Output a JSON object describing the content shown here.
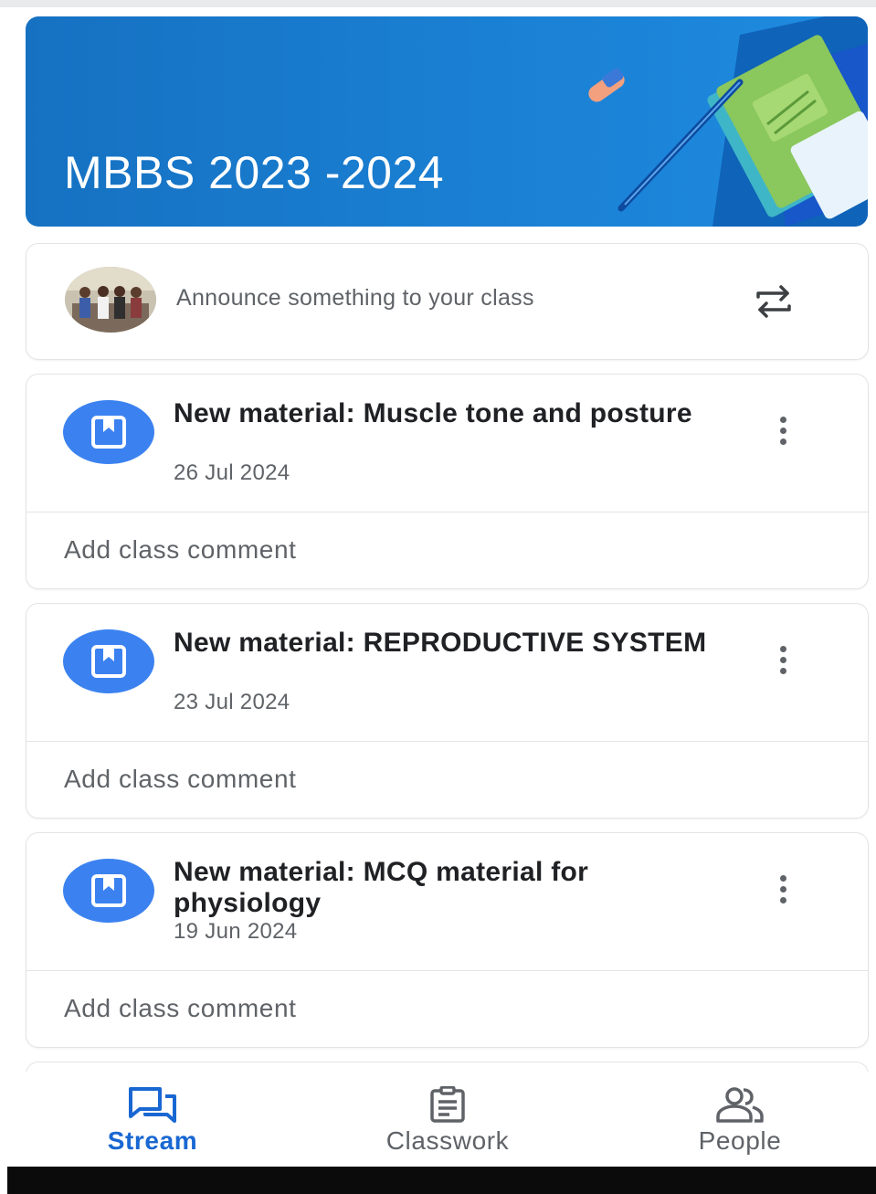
{
  "banner": {
    "title": "MBBS 2023 -2024",
    "colors": {
      "background": "#1a80d3"
    }
  },
  "announce": {
    "placeholder": "Announce something to your class",
    "avatar_icon": "class-photo-avatar",
    "repost_icon": "repost-icon"
  },
  "posts": [
    {
      "title": "New material: Muscle tone and posture",
      "date": "26 Jul 2024",
      "comment_label": "Add class comment",
      "icon": "material-bookmark-icon"
    },
    {
      "title": "New material: REPRODUCTIVE SYSTEM",
      "date": "23 Jul 2024",
      "comment_label": "Add class comment",
      "icon": "material-bookmark-icon"
    },
    {
      "title": "New material: MCQ material for physiology",
      "date": "19 Jun 2024",
      "comment_label": "Add class comment",
      "icon": "material-bookmark-icon"
    }
  ],
  "nav": {
    "stream": {
      "label": "Stream",
      "icon": "stream-icon",
      "active": true
    },
    "classwork": {
      "label": "Classwork",
      "icon": "classwork-icon"
    },
    "people": {
      "label": "People",
      "icon": "people-icon"
    }
  },
  "colors": {
    "accent": "#1967d2",
    "material_icon": "#3b82f0",
    "muted_text": "#5f6368"
  }
}
